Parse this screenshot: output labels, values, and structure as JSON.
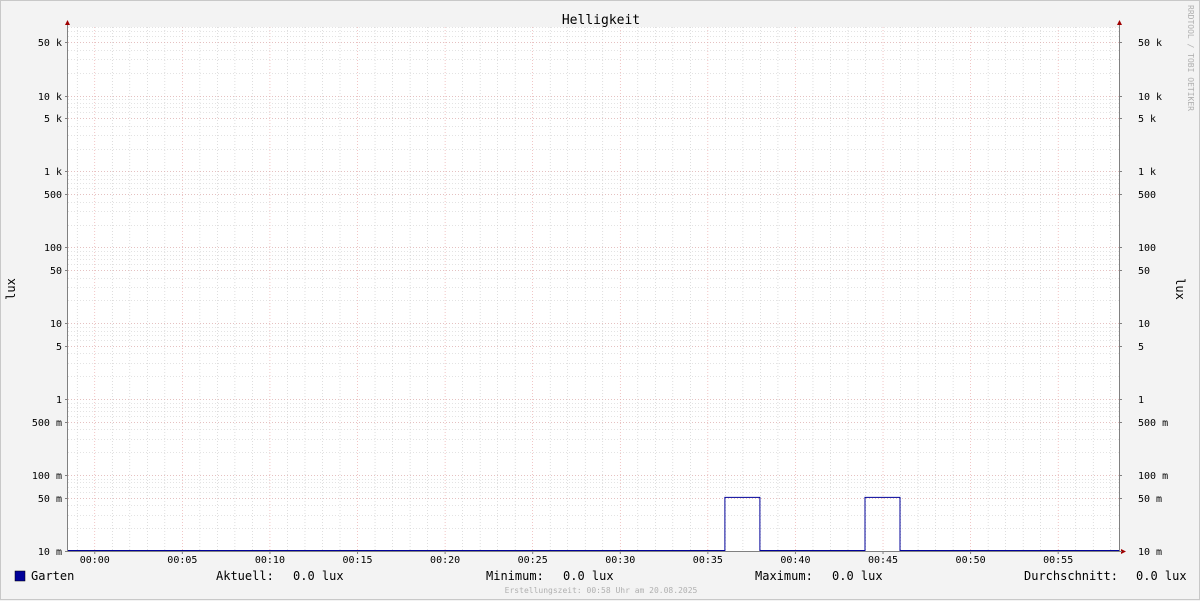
{
  "chart_data": {
    "type": "line",
    "title": "Helligkeit",
    "ylabel": "lux",
    "yscale": "log",
    "ylim": [
      0.01,
      80000
    ],
    "xlim": [
      "23:58:30",
      "00:58:30"
    ],
    "x_ticks": [
      "00:00",
      "00:05",
      "00:10",
      "00:15",
      "00:20",
      "00:25",
      "00:30",
      "00:35",
      "00:40",
      "00:45",
      "00:50",
      "00:55"
    ],
    "y_ticks": [
      {
        "value": 50000,
        "label": "50 k"
      },
      {
        "value": 10000,
        "label": "10 k"
      },
      {
        "value": 5000,
        "label": "5 k"
      },
      {
        "value": 1000,
        "label": "1 k"
      },
      {
        "value": 500,
        "label": "500"
      },
      {
        "value": 100,
        "label": "100"
      },
      {
        "value": 50,
        "label": "50"
      },
      {
        "value": 10,
        "label": "10"
      },
      {
        "value": 5,
        "label": "5"
      },
      {
        "value": 1,
        "label": "1"
      },
      {
        "value": 0.5,
        "label": "500 m"
      },
      {
        "value": 0.1,
        "label": "100 m"
      },
      {
        "value": 0.05,
        "label": "50 m"
      },
      {
        "value": 0.01,
        "label": "10 m"
      }
    ],
    "series": [
      {
        "name": "Garten",
        "color": "#000099",
        "points": [
          {
            "x": "23:58:30",
            "y": 0.0
          },
          {
            "x": "00:36:00",
            "y": 0.0
          },
          {
            "x": "00:36:00",
            "y": 0.05
          },
          {
            "x": "00:38:00",
            "y": 0.05
          },
          {
            "x": "00:38:00",
            "y": 0.0
          },
          {
            "x": "00:44:00",
            "y": 0.0
          },
          {
            "x": "00:44:00",
            "y": 0.05
          },
          {
            "x": "00:46:00",
            "y": 0.05
          },
          {
            "x": "00:46:00",
            "y": 0.0
          },
          {
            "x": "00:58:30",
            "y": 0.0
          }
        ]
      }
    ],
    "grid": true,
    "legend_position": "bottom"
  },
  "legend": {
    "series_name": "Garten",
    "swatch_color": "#000099",
    "stats": [
      {
        "label": "Aktuell:",
        "value": "0.0 lux"
      },
      {
        "label": "Minimum:",
        "value": "0.0 lux"
      },
      {
        "label": "Maximum:",
        "value": "0.0 lux"
      },
      {
        "label": "Durchschnitt:",
        "value": "0.0 lux"
      }
    ]
  },
  "credit": "RRDTOOL / TOBI OETIKER",
  "footer": "Erstellungszeit: 00:58 Uhr am 20.08.2025",
  "colors": {
    "background": "#f3f3f3",
    "canvas": "#ffffff",
    "major_grid": "#e8a0a0",
    "minor_grid": "#c8c8c8",
    "axis": "#808080",
    "arrow": "#a00000",
    "series": "#000099"
  }
}
